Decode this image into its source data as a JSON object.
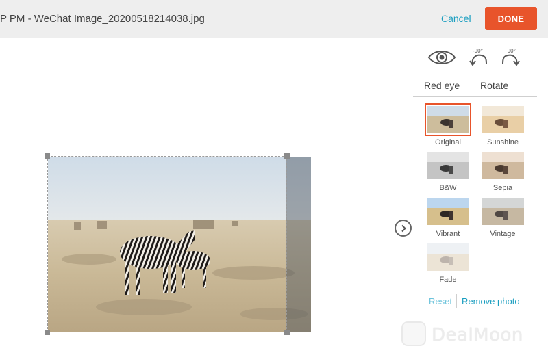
{
  "header": {
    "title": "P PM - WeChat Image_20200518214038.jpg",
    "cancel_label": "Cancel",
    "done_label": "DONE"
  },
  "tools": {
    "red_eye_label": "Red eye",
    "rotate_label": "Rotate",
    "rotate_left_caption": "-90°",
    "rotate_right_caption": "+90°"
  },
  "filters": [
    {
      "label": "Original",
      "selected": true
    },
    {
      "label": "Sunshine",
      "selected": false
    },
    {
      "label": "B&W",
      "selected": false
    },
    {
      "label": "Sepia",
      "selected": false
    },
    {
      "label": "Vibrant",
      "selected": false
    },
    {
      "label": "Vintage",
      "selected": false
    },
    {
      "label": "Fade",
      "selected": false
    }
  ],
  "actions": {
    "reset_label": "Reset",
    "remove_label": "Remove photo"
  },
  "watermark": {
    "text": "DealMoon"
  },
  "colors": {
    "accent": "#e8542b",
    "link": "#1a9ec0"
  }
}
